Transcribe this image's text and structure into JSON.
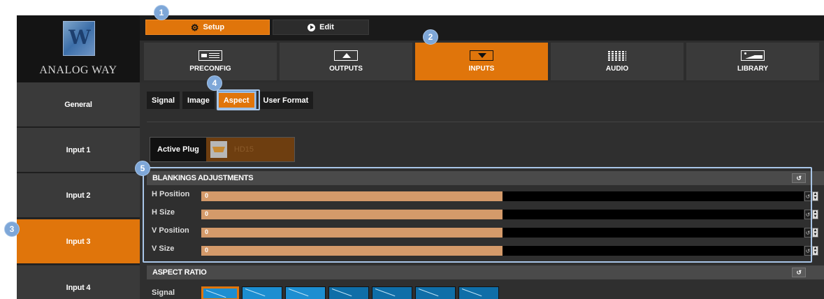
{
  "brand": {
    "logo_text": "ANALOG WAY",
    "logo_glyph": "W"
  },
  "modes": {
    "setup_label": "Setup",
    "edit_label": "Edit",
    "setup_icon": "gear-icon",
    "edit_icon": "play-circle-icon"
  },
  "main_tabs": [
    {
      "label": "PRECONFIG",
      "icon": "preconfig-icon",
      "active": false
    },
    {
      "label": "OUTPUTS",
      "icon": "outputs-icon",
      "active": false
    },
    {
      "label": "INPUTS",
      "icon": "inputs-icon",
      "active": true
    },
    {
      "label": "AUDIO",
      "icon": "audio-icon",
      "active": false
    },
    {
      "label": "LIBRARY",
      "icon": "library-icon",
      "active": false
    }
  ],
  "sidebar": {
    "items": [
      {
        "label": "General",
        "active": false
      },
      {
        "label": "Input 1",
        "active": false
      },
      {
        "label": "Input 2",
        "active": false
      },
      {
        "label": "Input 3",
        "active": true
      },
      {
        "label": "Input 4",
        "active": false
      }
    ]
  },
  "sub_tabs": [
    {
      "label": "Signal",
      "active": false
    },
    {
      "label": "Image",
      "active": false
    },
    {
      "label": "Aspect",
      "active": true
    },
    {
      "label": "User Format",
      "active": false
    }
  ],
  "active_plug": {
    "label": "Active Plug",
    "value": "HD15"
  },
  "blankings": {
    "title": "BLANKINGS ADJUSTMENTS",
    "rows": [
      {
        "label": "H Position",
        "value": "0",
        "fill_fraction": 0.5
      },
      {
        "label": "H Size",
        "value": "0",
        "fill_fraction": 0.5
      },
      {
        "label": "V Position",
        "value": "0",
        "fill_fraction": 0.5
      },
      {
        "label": "V Size",
        "value": "0",
        "fill_fraction": 0.5
      }
    ]
  },
  "aspect_ratio": {
    "title": "ASPECT RATIO",
    "signal_label": "Signal"
  },
  "callouts": [
    "1",
    "2",
    "3",
    "4",
    "5"
  ],
  "colors": {
    "accent": "#e0750b",
    "callout": "#7ea7d8",
    "slider_fill": "#d49a6a"
  }
}
